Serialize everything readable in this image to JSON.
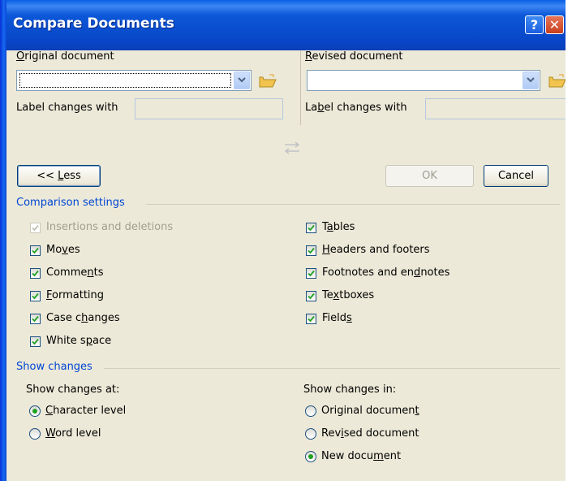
{
  "window": {
    "title": "Compare Documents",
    "help_icon": "question-mark-icon",
    "close_icon": "close-x-icon",
    "help_glyph": "?",
    "close_glyph": "✕",
    "title_color": "#0a4cd3"
  },
  "original": {
    "label_pre": "",
    "label_accel": "O",
    "label_post": "riginal document",
    "value": "",
    "changes_label_pre": "Label changes with",
    "changes_value": ""
  },
  "revised": {
    "label_pre": "",
    "label_accel": "R",
    "label_post": "evised document",
    "value": "",
    "changes_label_pre": "La",
    "changes_label_accel": "b",
    "changes_label_post": "el changes with",
    "changes_value": ""
  },
  "swap_icon": "swap-arrows-icon",
  "buttons": {
    "less_pre": "<< ",
    "less_accel": "L",
    "less_post": "ess",
    "ok": "OK",
    "cancel": "Cancel"
  },
  "comparison": {
    "title": "Comparison settings",
    "left": [
      {
        "pre": "Insertions and deletions",
        "accel": "",
        "post": "",
        "checked": true,
        "disabled": true
      },
      {
        "pre": "Mo",
        "accel": "v",
        "post": "es",
        "checked": true,
        "disabled": false
      },
      {
        "pre": "Comme",
        "accel": "n",
        "post": "ts",
        "checked": true,
        "disabled": false
      },
      {
        "pre": "",
        "accel": "F",
        "post": "ormatting",
        "checked": true,
        "disabled": false
      },
      {
        "pre": "Case c",
        "accel": "h",
        "post": "anges",
        "checked": true,
        "disabled": false
      },
      {
        "pre": "White s",
        "accel": "p",
        "post": "ace",
        "checked": true,
        "disabled": false
      }
    ],
    "right": [
      {
        "pre": "T",
        "accel": "a",
        "post": "bles",
        "checked": true
      },
      {
        "pre": "",
        "accel": "H",
        "post": "eaders and footers",
        "checked": true
      },
      {
        "pre": "Footnotes and en",
        "accel": "d",
        "post": "notes",
        "checked": true
      },
      {
        "pre": "Te",
        "accel": "x",
        "post": "tboxes",
        "checked": true
      },
      {
        "pre": "Field",
        "accel": "s",
        "post": "",
        "checked": true
      }
    ]
  },
  "show_changes": {
    "title": "Show changes",
    "at_label": "Show changes at:",
    "at_options": [
      {
        "pre": "",
        "accel": "C",
        "post": "haracter level",
        "selected": true
      },
      {
        "pre": "",
        "accel": "W",
        "post": "ord level",
        "selected": false
      }
    ],
    "in_label": "Show changes in:",
    "in_options": [
      {
        "pre": "Original documen",
        "accel": "t",
        "post": "",
        "selected": false
      },
      {
        "pre": "Rev",
        "accel": "i",
        "post": "sed document",
        "selected": false
      },
      {
        "pre": "New docu",
        "accel": "m",
        "post": "ent",
        "selected": true
      }
    ]
  }
}
